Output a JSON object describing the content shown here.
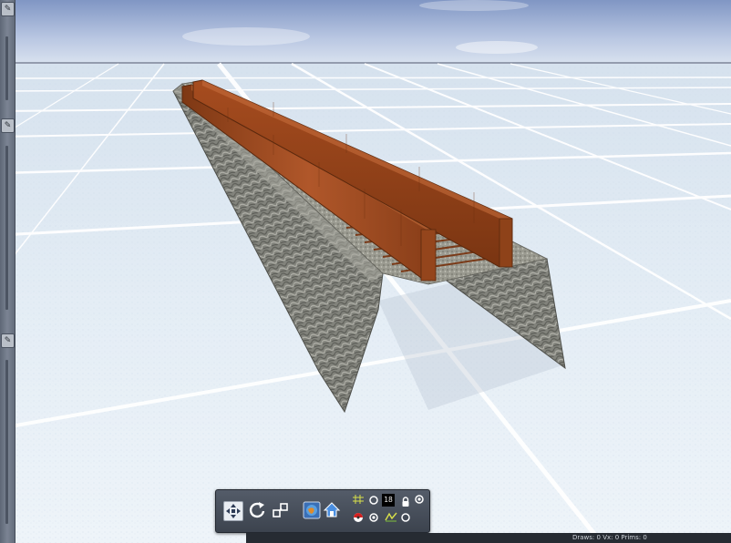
{
  "viewport": {
    "sky_top_color": "#8096c4",
    "sky_horizon_color": "#d9e2ef",
    "ground_color": "#e6eff6",
    "grid_line_color": "#ffffff",
    "object": "railway-bridge-model",
    "rail_color": "#9a4a1c",
    "wall_color": "#7f8079"
  },
  "sidebar": {
    "handles": [
      {
        "icon": "pin-icon",
        "glyph": "✎"
      },
      {
        "icon": "pin-icon",
        "glyph": "✎"
      },
      {
        "icon": "pin-icon",
        "glyph": "✎"
      }
    ]
  },
  "toolbar": {
    "tools": [
      {
        "name": "move-tool",
        "icon": "move-arrows-icon",
        "active": true
      },
      {
        "name": "rotate-tool",
        "icon": "rotate-icon",
        "active": false
      },
      {
        "name": "scale-tool",
        "icon": "scale-icon",
        "active": false
      },
      {
        "name": "globe-tool",
        "icon": "globe-icon",
        "active": false
      },
      {
        "name": "home-tool",
        "icon": "home-icon",
        "active": false
      }
    ],
    "snap_value": "18"
  },
  "status": {
    "text": "Draws: 0 Vx: 0 Prims: 0"
  }
}
